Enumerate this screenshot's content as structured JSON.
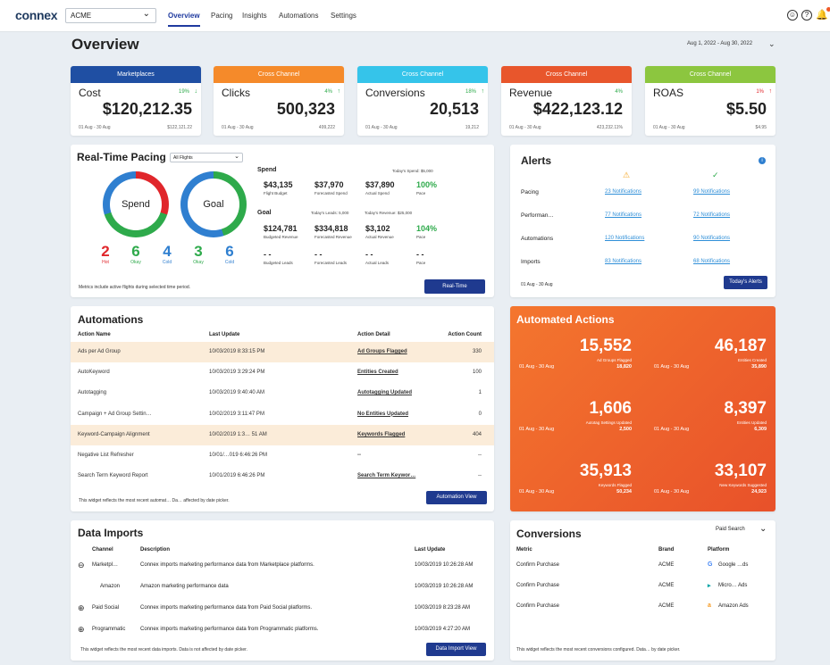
{
  "header": {
    "logo": "connex",
    "account": "ACME",
    "nav": [
      "Overview",
      "Pacing",
      "Insights",
      "Automations",
      "Settings"
    ],
    "icons": [
      "user-icon",
      "help-icon",
      "bell-icon"
    ]
  },
  "page": {
    "title": "Overview",
    "date_range": "Aug 1, 2022 - Aug 30, 2022"
  },
  "kpis": [
    {
      "header": "Marketplaces",
      "color": "#1f4fa3",
      "name": "Cost",
      "pct": "19%",
      "dir": "down",
      "value": "$120,212.35",
      "range": "01 Aug - 30 Aug",
      "prev": "$122,121.22"
    },
    {
      "header": "Cross Channel",
      "color": "#f58a2a",
      "name": "Clicks",
      "pct": "4%",
      "dir": "up",
      "value": "500,323",
      "range": "01 Aug - 30 Aug",
      "prev": "499,222"
    },
    {
      "header": "Cross Channel",
      "color": "#35c4ea",
      "name": "Conversions",
      "pct": "18%",
      "dir": "up",
      "value": "20,513",
      "range": "01 Aug - 30 Aug",
      "prev": "19,212"
    },
    {
      "header": "Cross Channel",
      "color": "#e8562c",
      "name": "Revenue",
      "pct": "4%",
      "dir": "none",
      "value": "$422,123.12",
      "range": "01 Aug - 30 Aug",
      "prev": "423,232.11%"
    },
    {
      "header": "Cross Channel",
      "color": "#8cc63f",
      "name": "ROAS",
      "pct": "1%",
      "dir": "up-red",
      "value": "$5.50",
      "range": "01 Aug - 30 Aug",
      "prev": "$4.95"
    }
  ],
  "pacing": {
    "title": "Real-Time Pacing",
    "filter": "All Flights",
    "ring1": "Spend",
    "ring2": "Goal",
    "counts": [
      {
        "n": "2",
        "l": "Hot",
        "color": "#e0262b"
      },
      {
        "n": "6",
        "l": "Okay",
        "color": "#2eaa4b"
      },
      {
        "n": "4",
        "l": "Cold",
        "color": "#2f7fd0"
      },
      {
        "n": "3",
        "l": "Okay",
        "color": "#2eaa4b"
      },
      {
        "n": "6",
        "l": "Cold",
        "color": "#2f7fd0"
      }
    ],
    "spend_label": "Spend",
    "todays_spend": "Today's Spend: $5,000",
    "spend_vals": [
      "$43,135",
      "$37,970",
      "$37,890",
      "100%"
    ],
    "spend_lbls": [
      "Flight Budget",
      "Forecasted Spend",
      "Actual Spend",
      "Pace"
    ],
    "goal_label": "Goal",
    "todays_leads": "Today's Leads: 5,000",
    "todays_revenue": "Today's Revenue: $25,000",
    "goal_vals": [
      "$124,781",
      "$334,818",
      "$3,102",
      "104%"
    ],
    "goal_lbls": [
      "Budgeted Revenue",
      "Forecasted Revenue",
      "Actual Revenue",
      "Pace"
    ],
    "lead_vals": [
      "- -",
      "- -",
      "- -",
      "- -"
    ],
    "lead_lbls": [
      "Budgeted Leads",
      "Forecasted Leads",
      "Actual Leads",
      "Pace"
    ],
    "footnote": "Metrics include active flights during selected time period.",
    "button": "Real-Time"
  },
  "alerts": {
    "title": "Alerts",
    "rows": [
      {
        "label": "Pacing",
        "warn": "23 Notifications",
        "ok": "99 Notifications"
      },
      {
        "label": "Performan…",
        "warn": "77 Notifications",
        "ok": "72 Notifications"
      },
      {
        "label": "Automations",
        "warn": "120 Notifications",
        "ok": "90 Notifications"
      },
      {
        "label": "Imports",
        "warn": "83 Notifications",
        "ok": "68 Notifications"
      }
    ],
    "range": "01 Aug - 30 Aug",
    "button": "Today's Alerts"
  },
  "automations": {
    "title": "Automations",
    "headers": [
      "Action Name",
      "Last Update",
      "Action Detail",
      "Action Count"
    ],
    "rows": [
      {
        "name": "Ads per Ad Group",
        "updated": "10/03/2019 8:33:15 PM",
        "detail": "Ad Groups Flagged",
        "count": "330",
        "hl": true
      },
      {
        "name": "AutoKeyword",
        "updated": "10/03/2019 3:29:24 PM",
        "detail": "Entities Created",
        "count": "100",
        "hl": false
      },
      {
        "name": "Autotagging",
        "updated": "10/03/2019 9:40:40 AM",
        "detail": "Autotagging Updated",
        "count": "1",
        "hl": false
      },
      {
        "name": "Campaign + Ad Group Settin…",
        "updated": "10/02/2019 3:11:47 PM",
        "detail": "No Entities Updated",
        "count": "0",
        "hl": false
      },
      {
        "name": "Keyword-Campaign Alignment",
        "updated": "10/02/2019 1:3… 51 AM",
        "detail": "Keywords Flagged",
        "count": "404",
        "hl": true
      },
      {
        "name": "Negative List Refresher",
        "updated": "10/01/…019 6:46:26 PM",
        "detail": "--",
        "count": "--",
        "hl": false
      },
      {
        "name": "Search Term Keyword Report",
        "updated": "10/01/2019 6:46:26 PM",
        "detail": "Search Term Keywor…",
        "count": "--",
        "hl": false
      }
    ],
    "footnote": "This widget reflects the most recent automat… Da… affected by date picker.",
    "button": "Automation View"
  },
  "automated_actions": {
    "title": "Automated Actions",
    "items": [
      {
        "value": "15,552",
        "label": "Ad Groups Flagged",
        "range": "01 Aug - 30 Aug",
        "prev": "18,820"
      },
      {
        "value": "46,187",
        "label": "Entities Created",
        "range": "01 Aug - 30 Aug",
        "prev": "35,890"
      },
      {
        "value": "1,606",
        "label": "Autotag Settings Updated",
        "range": "01 Aug - 30 Aug",
        "prev": "2,500"
      },
      {
        "value": "8,397",
        "label": "Entities Updated",
        "range": "01 Aug - 30 Aug",
        "prev": "6,309"
      },
      {
        "value": "35,913",
        "label": "Keywords Flagged",
        "range": "01 Aug - 30 Aug",
        "prev": "50,234"
      },
      {
        "value": "33,107",
        "label": "New Keywords Suggested",
        "range": "01 Aug - 30 Aug",
        "prev": "24,923"
      }
    ]
  },
  "imports": {
    "title": "Data Imports",
    "headers": [
      "Channel",
      "Description",
      "Last Update"
    ],
    "rows": [
      {
        "sym": "⊖",
        "channel": "Marketpl…",
        "desc": "Connex imports marketing performance data from Marketplace platforms.",
        "updated": "10/03/2019 10:26:28 AM"
      },
      {
        "sym": "",
        "channel": "Amazon",
        "desc": "Amazon marketing performance data",
        "updated": "10/03/2019 10:26:28 AM"
      },
      {
        "sym": "⊕",
        "channel": "Paid Social",
        "desc": "Connex imports marketing performance data from Paid Social platforms.",
        "updated": "10/03/2019 8:23:28 AM"
      },
      {
        "sym": "⊕",
        "channel": "Programmatic",
        "desc": "Connex imports marketing performance data from Programmatic platforms.",
        "updated": "10/03/2019 4:27:20 AM"
      }
    ],
    "footnote": "This widget reflects the most recent data imports. Data is not affected by date picker.",
    "button": "Data Import View"
  },
  "conversions": {
    "title": "Conversions",
    "filter": "Paid Search",
    "headers": [
      "Metric",
      "Brand",
      "Platform"
    ],
    "rows": [
      {
        "metric": "Confirm Purchase",
        "brand": "ACME",
        "platform": "Google …ds",
        "icon": "G",
        "icolor": "#4285f4"
      },
      {
        "metric": "Confirm Purchase",
        "brand": "ACME",
        "platform": "Micro… Ads",
        "icon": "▸",
        "icolor": "#00a4a6"
      },
      {
        "metric": "Confirm Purchase",
        "brand": "ACME",
        "platform": "Amazon Ads",
        "icon": "a",
        "icolor": "#f59a23"
      }
    ],
    "footnote": "This widget reflects the most recent conversions configured. Data… by date picker."
  }
}
